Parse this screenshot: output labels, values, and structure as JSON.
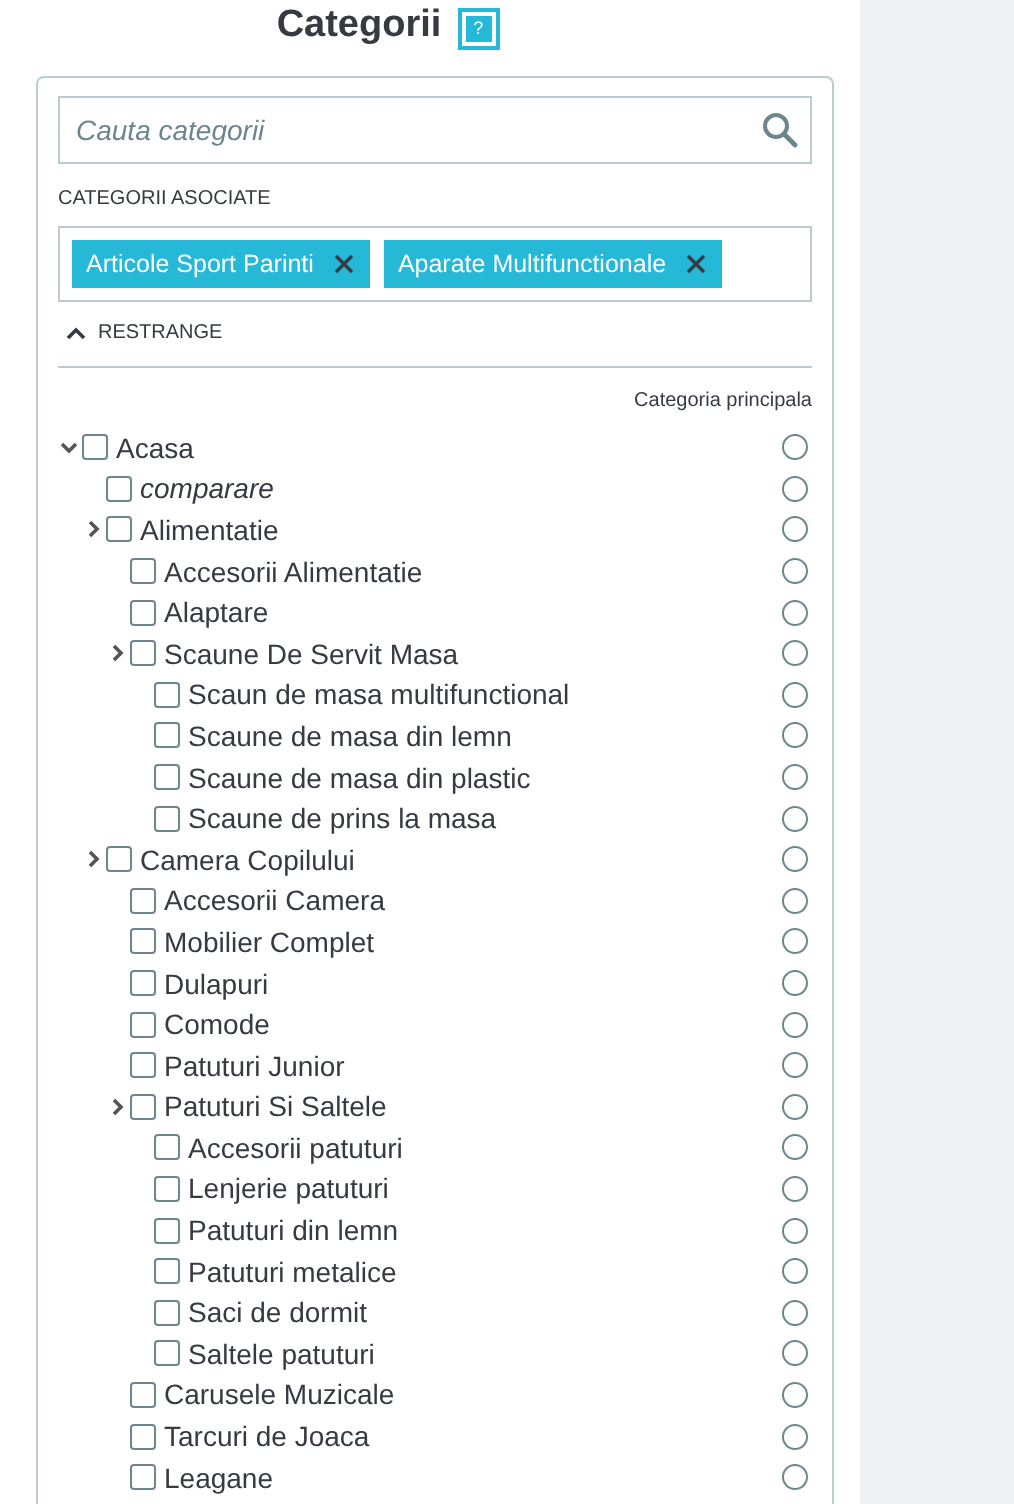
{
  "title": "Categorii",
  "help_icon": "?",
  "search": {
    "placeholder": "Cauta categorii"
  },
  "associated": {
    "label": "CATEGORII ASOCIATE",
    "tags": [
      {
        "label": "Articole Sport Parinti"
      },
      {
        "label": "Aparate Multifunctionale"
      }
    ]
  },
  "collapse_link": "RESTRANGE",
  "main_column_label": "Categoria principala",
  "tree": [
    {
      "label": "Acasa",
      "expanded": true,
      "checked": false,
      "italic": false,
      "selected": false,
      "children": [
        {
          "label": "comparare",
          "checked": false,
          "italic": true,
          "selected": false
        },
        {
          "label": "Alimentatie",
          "expanded": false,
          "checked": false,
          "italic": false,
          "selected": false,
          "children": [
            {
              "label": "Accesorii Alimentatie",
              "checked": false,
              "italic": false,
              "selected": false
            },
            {
              "label": "Alaptare",
              "checked": false,
              "italic": false,
              "selected": false
            },
            {
              "label": "Scaune De Servit Masa",
              "expanded": false,
              "checked": false,
              "italic": false,
              "selected": false,
              "children": [
                {
                  "label": "Scaun de masa multifunctional",
                  "checked": false,
                  "italic": false,
                  "selected": false
                },
                {
                  "label": "Scaune de masa din lemn",
                  "checked": false,
                  "italic": false,
                  "selected": false
                },
                {
                  "label": "Scaune de masa din plastic",
                  "checked": false,
                  "italic": false,
                  "selected": false
                },
                {
                  "label": "Scaune de prins la masa",
                  "checked": false,
                  "italic": false,
                  "selected": false
                }
              ]
            }
          ]
        },
        {
          "label": "Camera Copilului",
          "expanded": false,
          "checked": false,
          "italic": false,
          "selected": false,
          "children": [
            {
              "label": "Accesorii Camera",
              "checked": false,
              "italic": false,
              "selected": false
            },
            {
              "label": "Mobilier Complet",
              "checked": false,
              "italic": false,
              "selected": false
            },
            {
              "label": "Dulapuri",
              "checked": false,
              "italic": false,
              "selected": false
            },
            {
              "label": "Comode",
              "checked": false,
              "italic": false,
              "selected": false
            },
            {
              "label": "Patuturi Junior",
              "checked": false,
              "italic": false,
              "selected": false
            },
            {
              "label": "Patuturi Si Saltele",
              "expanded": false,
              "checked": false,
              "italic": false,
              "selected": false,
              "children": [
                {
                  "label": "Accesorii patuturi",
                  "checked": false,
                  "italic": false,
                  "selected": false
                },
                {
                  "label": "Lenjerie patuturi",
                  "checked": false,
                  "italic": false,
                  "selected": false
                },
                {
                  "label": "Patuturi din lemn",
                  "checked": false,
                  "italic": false,
                  "selected": false
                },
                {
                  "label": "Patuturi metalice",
                  "checked": false,
                  "italic": false,
                  "selected": false
                },
                {
                  "label": "Saci de dormit",
                  "checked": false,
                  "italic": false,
                  "selected": false
                },
                {
                  "label": "Saltele patuturi",
                  "checked": false,
                  "italic": false,
                  "selected": false
                }
              ]
            },
            {
              "label": "Carusele Muzicale",
              "checked": false,
              "italic": false,
              "selected": false
            },
            {
              "label": "Tarcuri de Joaca",
              "checked": false,
              "italic": false,
              "selected": false
            },
            {
              "label": "Leagane",
              "checked": false,
              "italic": false,
              "selected": false
            }
          ]
        }
      ]
    }
  ]
}
